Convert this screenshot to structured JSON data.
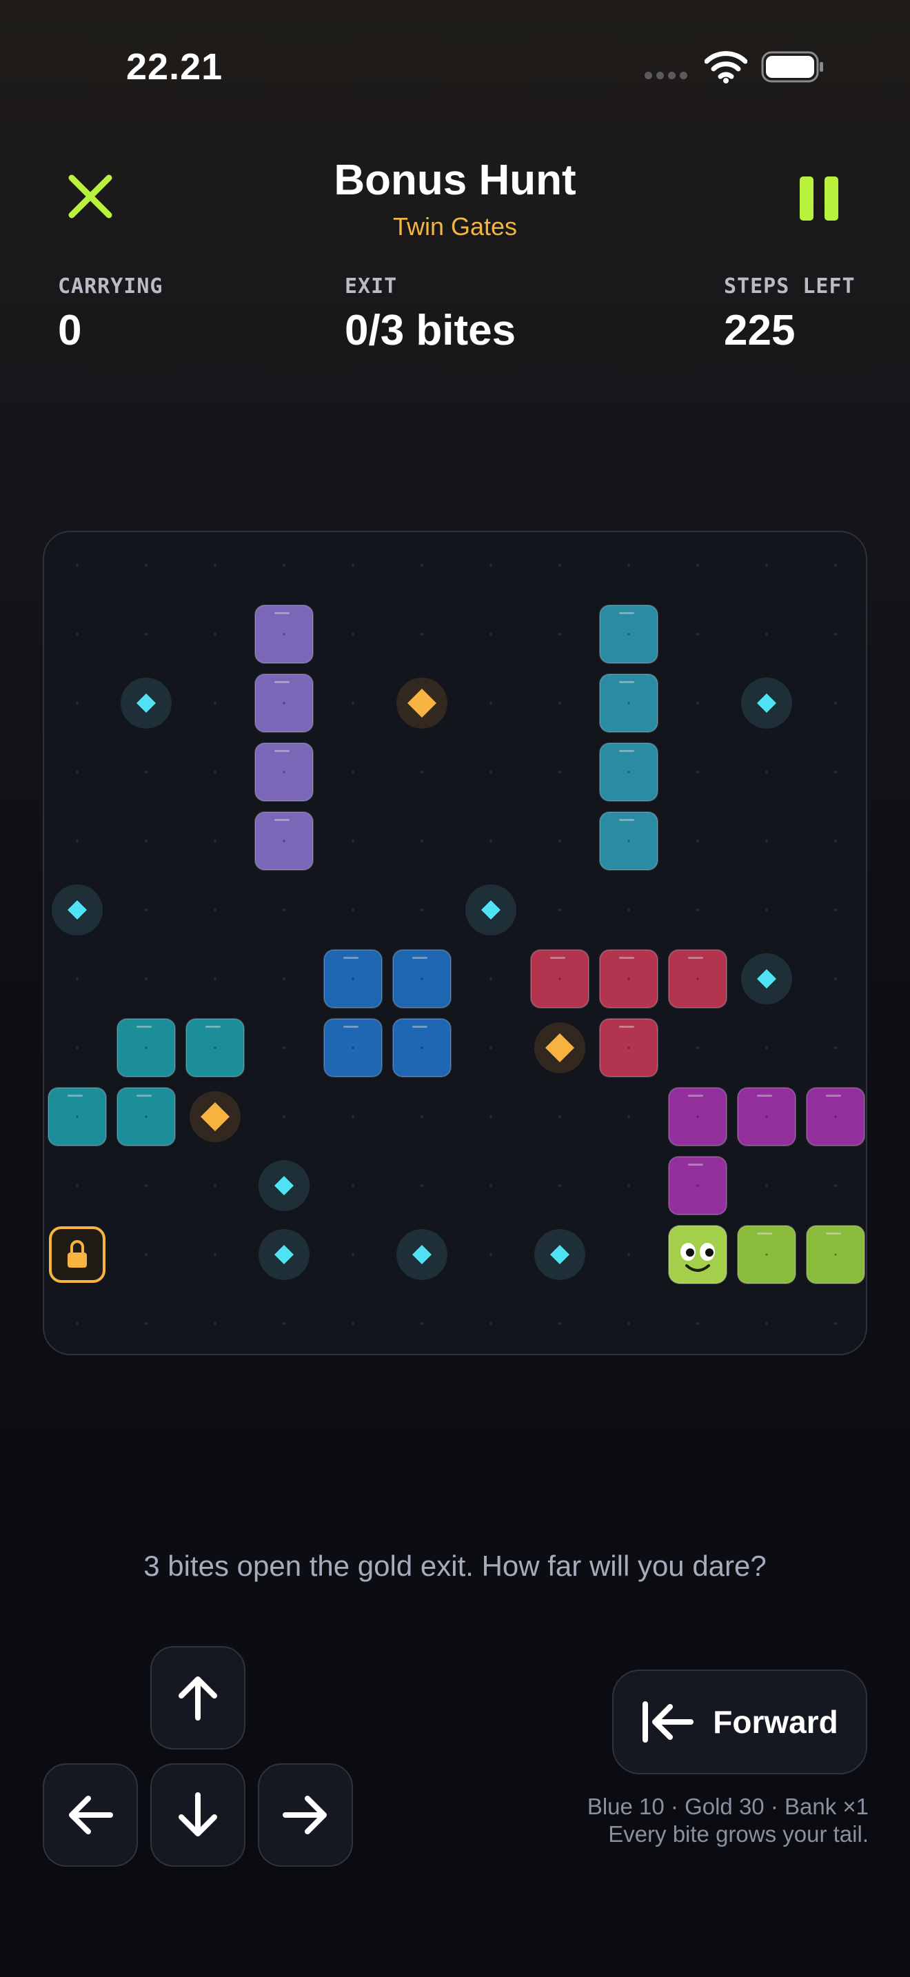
{
  "status_bar": {
    "time": "22.21"
  },
  "header": {
    "title": "Bonus Hunt",
    "subtitle": "Twin Gates"
  },
  "stats": {
    "carrying_label": "CARRYING",
    "carrying_value": "0",
    "exit_label": "EXIT",
    "exit_value": "0/3 bites",
    "steps_label": "STEPS LEFT",
    "steps_value": "225"
  },
  "board": {
    "cols": 12,
    "rows": 12,
    "colors": {
      "background": "#13151c",
      "grid_dot": "#262a33",
      "purple": "#7a67b8",
      "teal": "#2b8ba3",
      "blue": "#1f67b2",
      "red": "#b3344e",
      "cyan": "#1b8e99",
      "magenta": "#94309e",
      "snake": "#8bbb3c",
      "gem_blue": "#4fe3f5",
      "gem_gold": "#f7b441",
      "lock": "#f7b441"
    },
    "blocks": [
      {
        "color": "purple",
        "cells": [
          [
            3,
            1
          ],
          [
            3,
            2
          ],
          [
            3,
            3
          ],
          [
            3,
            4
          ]
        ]
      },
      {
        "color": "teal",
        "cells": [
          [
            8,
            1
          ],
          [
            8,
            2
          ],
          [
            8,
            3
          ],
          [
            8,
            4
          ]
        ]
      },
      {
        "color": "blue",
        "cells": [
          [
            4,
            6
          ],
          [
            5,
            6
          ],
          [
            4,
            7
          ],
          [
            5,
            7
          ]
        ]
      },
      {
        "color": "red",
        "cells": [
          [
            7,
            6
          ],
          [
            8,
            6
          ],
          [
            9,
            6
          ],
          [
            8,
            7
          ]
        ]
      },
      {
        "color": "cyan",
        "cells": [
          [
            1,
            7
          ],
          [
            2,
            7
          ],
          [
            0,
            8
          ],
          [
            1,
            8
          ]
        ]
      },
      {
        "color": "magenta",
        "cells": [
          [
            9,
            8
          ],
          [
            10,
            8
          ],
          [
            11,
            8
          ],
          [
            9,
            9
          ]
        ]
      }
    ],
    "snake": {
      "head": [
        9,
        10
      ],
      "body": [
        [
          10,
          10
        ],
        [
          11,
          10
        ]
      ]
    },
    "blue_gems": [
      [
        1,
        2
      ],
      [
        10,
        2
      ],
      [
        0,
        5
      ],
      [
        6,
        5
      ],
      [
        10,
        6
      ],
      [
        3,
        9
      ],
      [
        3,
        10
      ],
      [
        5,
        10
      ],
      [
        7,
        10
      ]
    ],
    "gold_gems": [
      [
        5,
        2
      ],
      [
        7,
        7
      ],
      [
        2,
        8
      ]
    ],
    "exit_lock": [
      0,
      10
    ]
  },
  "hint": "3 bites open the gold exit. How far will you dare?",
  "controls": {
    "up": "arrow-up",
    "down": "arrow-down",
    "left": "arrow-left",
    "right": "arrow-right",
    "forward_label": "Forward"
  },
  "info": {
    "line1": "Blue 10 · Gold 30 · Bank ×1",
    "line2": "Every bite grows your tail."
  },
  "colors": {
    "accent_green": "#b9f23c",
    "accent_gold": "#f2b542"
  }
}
